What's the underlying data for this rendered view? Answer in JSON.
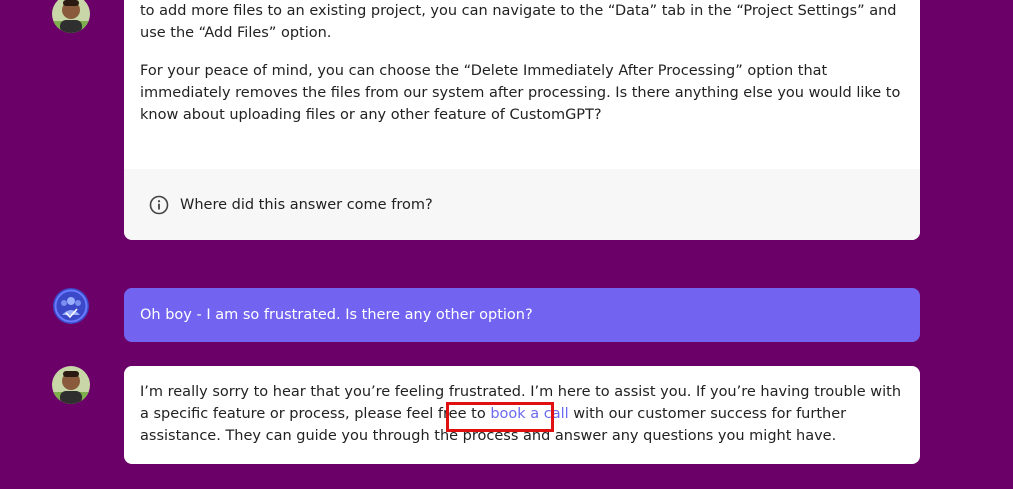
{
  "messages": {
    "assistant_first": {
      "partial_line": "dashboard and using the “Upload” feature. This feature is part of the “Create Project” flow. If you want to add more files to an existing project, you can navigate to the “Data” tab in the “Project Settings” and use the “Add Files” option.",
      "paragraph_2": "For your peace of mind, you can choose the “Delete Immediately After Processing” option that immediately removes the files from our system after processing. Is there anything else you would like to know about uploading files or any other feature of CustomGPT?",
      "source_prompt": "Where did this answer come from?"
    },
    "user": {
      "text": "Oh boy - I am so frustrated. Is there any other option?"
    },
    "assistant_second": {
      "text_before_link": "I’m really sorry to hear that you’re feeling frustrated. I’m here to assist you. If you’re having trouble with a specific feature or process, please feel free to ",
      "link_text": "book a call",
      "text_after_link": " with our customer success for further assistance. They can guide you through the process and answer any questions you might have."
    }
  },
  "icons": {
    "info": "info-circle-icon",
    "assistant_avatar": "assistant-avatar",
    "user_avatar": "user-logo-avatar"
  },
  "colors": {
    "background": "#6b0068",
    "user_bubble": "#7264f0",
    "link": "#6b6bf0",
    "highlight": "#e01010"
  }
}
